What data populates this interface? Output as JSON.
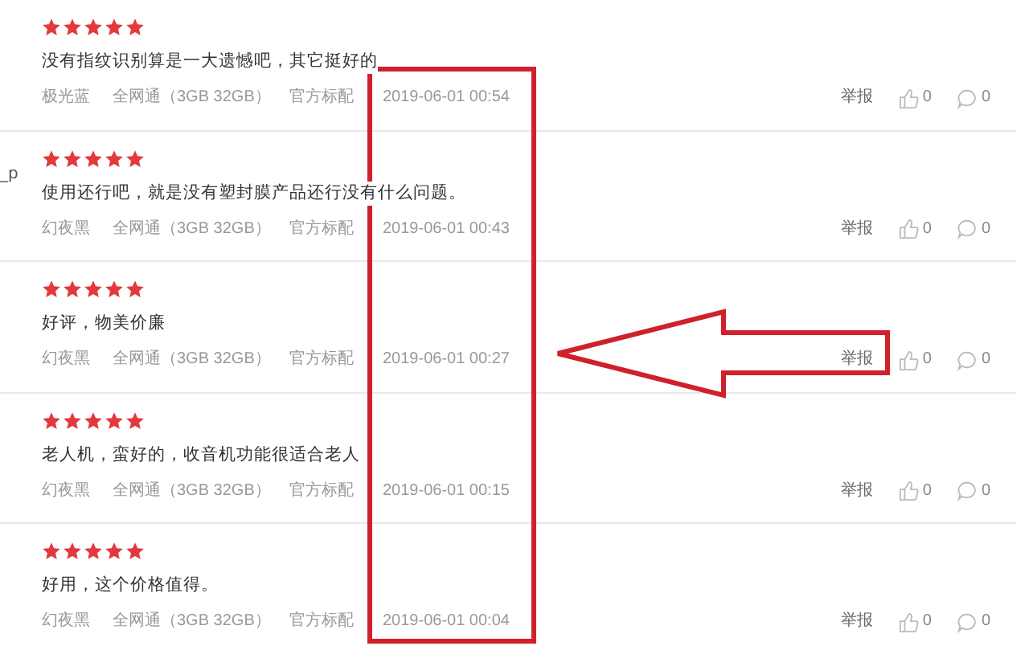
{
  "reviews": [
    {
      "stars": 5,
      "text": "没有指纹识别算是一大遗憾吧，其它挺好的",
      "color_name": "极光蓝",
      "spec": "全网通（3GB 32GB）",
      "package": "官方标配",
      "date": "2019-06-01 00:54",
      "report": "举报",
      "likes": "0",
      "replies": "0"
    },
    {
      "user": "_p",
      "stars": 5,
      "text": "使用还行吧，就是没有塑封膜产品还行没有什么问题。",
      "color_name": "幻夜黑",
      "spec": "全网通（3GB 32GB）",
      "package": "官方标配",
      "date": "2019-06-01 00:43",
      "report": "举报",
      "likes": "0",
      "replies": "0"
    },
    {
      "stars": 5,
      "text": "好评，物美价廉",
      "color_name": "幻夜黑",
      "spec": "全网通（3GB 32GB）",
      "package": "官方标配",
      "date": "2019-06-01 00:27",
      "report": "举报",
      "likes": "0",
      "replies": "0"
    },
    {
      "stars": 5,
      "text": "老人机，蛮好的，收音机功能很适合老人",
      "color_name": "幻夜黑",
      "spec": "全网通（3GB 32GB）",
      "package": "官方标配",
      "date": "2019-06-01 00:15",
      "report": "举报",
      "likes": "0",
      "replies": "0"
    },
    {
      "stars": 5,
      "text": "好用，这个价格值得。",
      "color_name": "幻夜黑",
      "spec": "全网通（3GB 32GB）",
      "package": "官方标配",
      "date": "2019-06-01 00:04",
      "report": "举报",
      "likes": "0",
      "replies": "0"
    }
  ]
}
